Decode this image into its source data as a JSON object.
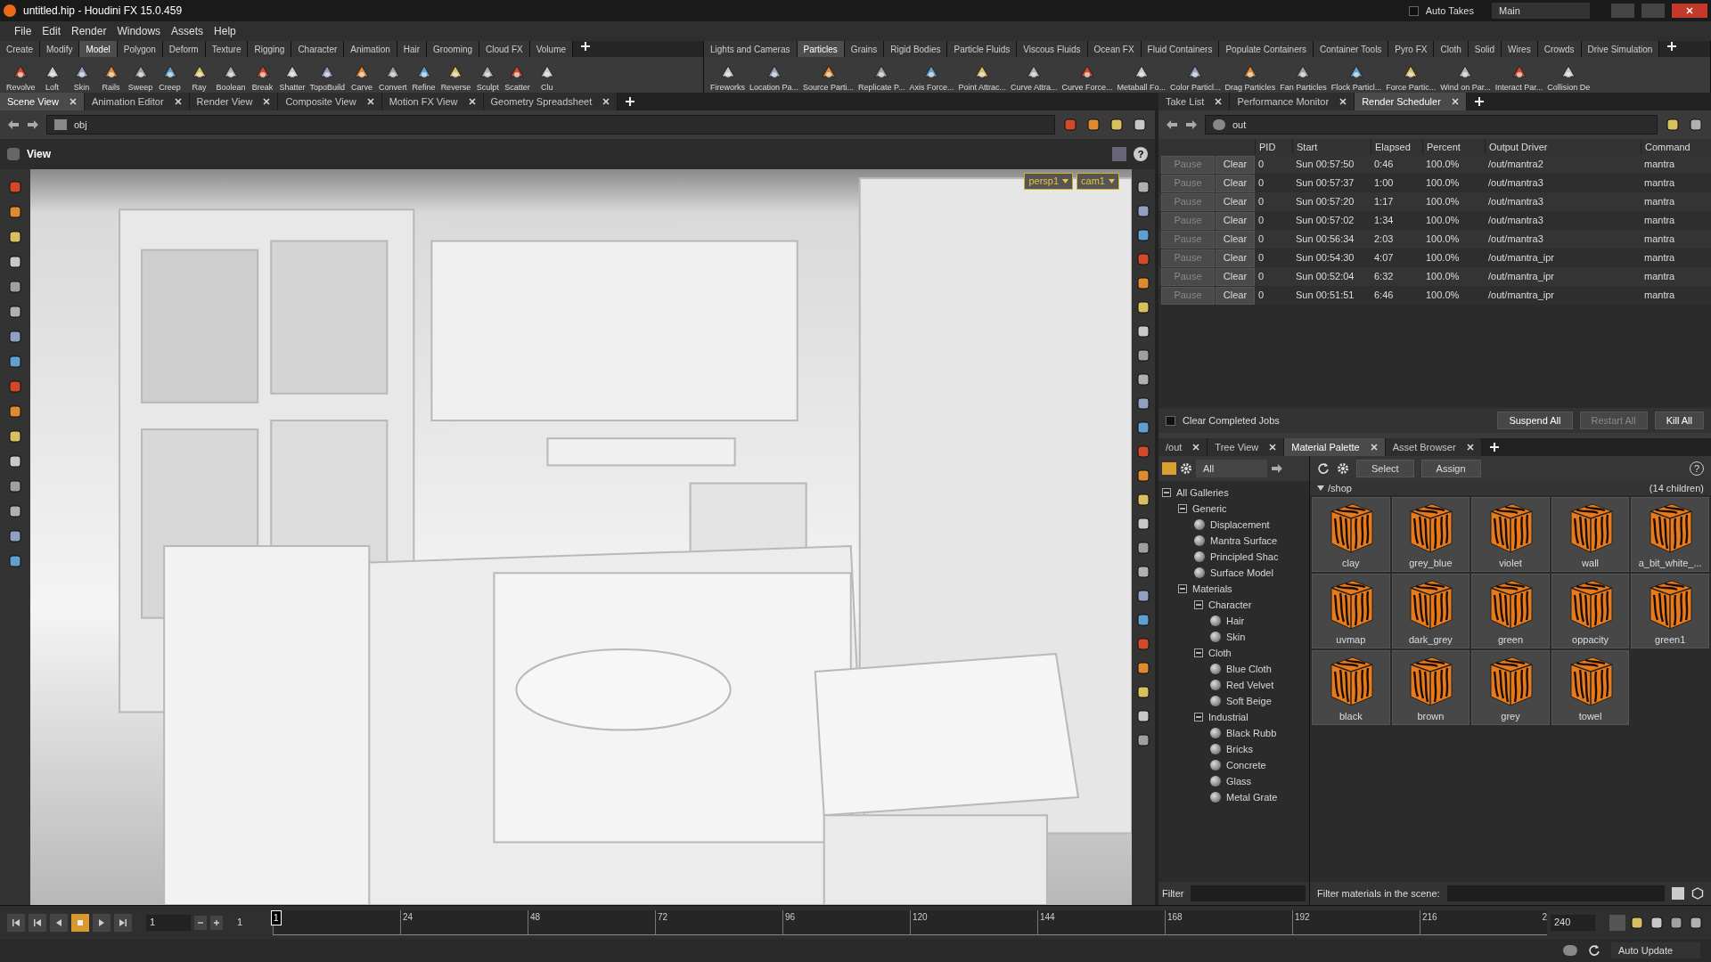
{
  "window": {
    "title": "untitled.hip - Houdini FX 15.0.459",
    "auto_takes": {
      "label": "Auto Takes",
      "checked": false
    },
    "desktop": "Main"
  },
  "menu": [
    "File",
    "Edit",
    "Render",
    "Windows",
    "Assets",
    "Help"
  ],
  "shelves": [
    {
      "tabs": [
        {
          "label": "Create",
          "selected": false
        },
        {
          "label": "Modify",
          "selected": false
        },
        {
          "label": "Model",
          "selected": true
        },
        {
          "label": "Polygon",
          "selected": false
        },
        {
          "label": "Deform",
          "selected": false
        },
        {
          "label": "Texture",
          "selected": false
        },
        {
          "label": "Rigging",
          "selected": false
        },
        {
          "label": "Character",
          "selected": false
        },
        {
          "label": "Animation",
          "selected": false
        },
        {
          "label": "Hair",
          "selected": false
        },
        {
          "label": "Grooming",
          "selected": false
        },
        {
          "label": "Cloud FX",
          "selected": false
        },
        {
          "label": "Volume",
          "selected": false
        }
      ],
      "tools": [
        "Revolve",
        "Loft",
        "Skin",
        "Rails",
        "Sweep",
        "Creep",
        "Ray",
        "Boolean",
        "Break",
        "Shatter",
        "TopoBuild",
        "Carve",
        "Convert",
        "Refine",
        "Reverse",
        "Sculpt",
        "Scatter",
        "Clu"
      ]
    },
    {
      "tabs": [
        {
          "label": "Lights and Cameras",
          "selected": false
        },
        {
          "label": "Particles",
          "selected": true
        },
        {
          "label": "Grains",
          "selected": false
        },
        {
          "label": "Rigid Bodies",
          "selected": false
        },
        {
          "label": "Particle Fluids",
          "selected": false
        },
        {
          "label": "Viscous Fluids",
          "selected": false
        },
        {
          "label": "Ocean FX",
          "selected": false
        },
        {
          "label": "Fluid Containers",
          "selected": false
        },
        {
          "label": "Populate Containers",
          "selected": false
        },
        {
          "label": "Container Tools",
          "selected": false
        },
        {
          "label": "Pyro FX",
          "selected": false
        },
        {
          "label": "Cloth",
          "selected": false
        },
        {
          "label": "Solid",
          "selected": false
        },
        {
          "label": "Wires",
          "selected": false
        },
        {
          "label": "Crowds",
          "selected": false
        },
        {
          "label": "Drive Simulation",
          "selected": false
        }
      ],
      "tools": [
        "Fireworks",
        "Location Pa...",
        "Source Parti...",
        "Replicate P...",
        "Axis Force...",
        "Point Attrac...",
        "Curve Attra...",
        "Curve Force...",
        "Metaball Fo...",
        "Color Particl...",
        "Drag Particles",
        "Fan Particles",
        "Flock Particl...",
        "Force Partic...",
        "Wind on Par...",
        "Interact Par...",
        "Collision De"
      ]
    }
  ],
  "scene_view": {
    "tabs": [
      {
        "label": "Scene View",
        "selected": true
      },
      {
        "label": "Animation Editor",
        "selected": false
      },
      {
        "label": "Render View",
        "selected": false
      },
      {
        "label": "Composite View",
        "selected": false
      },
      {
        "label": "Motion FX View",
        "selected": false
      },
      {
        "label": "Geometry Spreadsheet",
        "selected": false
      }
    ],
    "path": "obj",
    "view_title": "View",
    "camera_menus": [
      "persp1",
      "cam1"
    ],
    "help": "?"
  },
  "render_scheduler": {
    "tabs": [
      {
        "label": "Take List",
        "selected": false
      },
      {
        "label": "Performance Monitor",
        "selected": false
      },
      {
        "label": "Render Scheduler",
        "selected": true
      }
    ],
    "path": "out",
    "columns": [
      "PID",
      "Start",
      "Elapsed",
      "Percent",
      "Output Driver",
      "Command"
    ],
    "rows": [
      {
        "pause": {
          "label": "Pause",
          "disabled": true
        },
        "clear": "Clear",
        "cells": [
          "0",
          "Sun 00:57:50",
          "0:46",
          "100.0%",
          "/out/mantra2",
          "mantra"
        ]
      },
      {
        "pause": {
          "label": "Pause",
          "disabled": true
        },
        "clear": "Clear",
        "cells": [
          "0",
          "Sun 00:57:37",
          "1:00",
          "100.0%",
          "/out/mantra3",
          "mantra"
        ]
      },
      {
        "pause": {
          "label": "Pause",
          "disabled": true
        },
        "clear": "Clear",
        "cells": [
          "0",
          "Sun 00:57:20",
          "1:17",
          "100.0%",
          "/out/mantra3",
          "mantra"
        ]
      },
      {
        "pause": {
          "label": "Pause",
          "disabled": true
        },
        "clear": "Clear",
        "cells": [
          "0",
          "Sun 00:57:02",
          "1:34",
          "100.0%",
          "/out/mantra3",
          "mantra"
        ]
      },
      {
        "pause": {
          "label": "Pause",
          "disabled": true
        },
        "clear": "Clear",
        "cells": [
          "0",
          "Sun 00:56:34",
          "2:03",
          "100.0%",
          "/out/mantra3",
          "mantra"
        ]
      },
      {
        "pause": {
          "label": "Pause",
          "disabled": true
        },
        "clear": "Clear",
        "cells": [
          "0",
          "Sun 00:54:30",
          "4:07",
          "100.0%",
          "/out/mantra_ipr",
          "mantra"
        ]
      },
      {
        "pause": {
          "label": "Pause",
          "disabled": true
        },
        "clear": "Clear",
        "cells": [
          "0",
          "Sun 00:52:04",
          "6:32",
          "100.0%",
          "/out/mantra_ipr",
          "mantra"
        ]
      },
      {
        "pause": {
          "label": "Pause",
          "disabled": true
        },
        "clear": "Clear",
        "cells": [
          "0",
          "Sun 00:51:51",
          "6:46",
          "100.0%",
          "/out/mantra_ipr",
          "mantra"
        ]
      }
    ],
    "clear_completed": {
      "label": "Clear Completed Jobs",
      "checked": false
    },
    "buttons": [
      {
        "label": "Suspend All",
        "disabled": false
      },
      {
        "label": "Restart All",
        "disabled": true
      },
      {
        "label": "Kill All",
        "disabled": false
      }
    ]
  },
  "material_palette": {
    "tabs": [
      {
        "label": "/out",
        "selected": false
      },
      {
        "label": "Tree View",
        "selected": false
      },
      {
        "label": "Material Palette",
        "selected": true
      },
      {
        "label": "Asset Browser",
        "selected": false
      }
    ],
    "gallery_filter": "All",
    "tree": [
      {
        "label": "All Galleries",
        "expanded": true,
        "children": [
          {
            "label": "Generic",
            "expanded": true,
            "children": [
              {
                "label": "Displacement"
              },
              {
                "label": "Mantra Surface"
              },
              {
                "label": "Principled Shac"
              },
              {
                "label": "Surface Model"
              }
            ]
          },
          {
            "label": "Materials",
            "expanded": true,
            "children": [
              {
                "label": "Character",
                "expanded": true,
                "children": [
                  {
                    "label": "Hair"
                  },
                  {
                    "label": "Skin"
                  }
                ]
              },
              {
                "label": "Cloth",
                "expanded": true,
                "children": [
                  {
                    "label": "Blue Cloth"
                  },
                  {
                    "label": "Red Velvet"
                  },
                  {
                    "label": "Soft Beige"
                  }
                ]
              },
              {
                "label": "Industrial",
                "expanded": true,
                "children": [
                  {
                    "label": "Black Rubb"
                  },
                  {
                    "label": "Bricks"
                  },
                  {
                    "label": "Concrete"
                  },
                  {
                    "label": "Glass"
                  },
                  {
                    "label": "Metal Grate"
                  }
                ]
              }
            ]
          }
        ]
      }
    ],
    "filter_label": "Filter",
    "buttons": [
      "Select",
      "Assign"
    ],
    "shop_path": "/shop",
    "children_count": "(14 children)",
    "materials": [
      "clay",
      "grey_blue",
      "violet",
      "wall",
      "a_bit_white_...",
      "uvmap",
      "dark_grey",
      "green",
      "oppacity",
      "green1",
      "black",
      "brown",
      "grey",
      "towel"
    ],
    "scene_filter_label": "Filter materials in the scene:",
    "help": "?"
  },
  "timeline": {
    "start": "1",
    "current": "1",
    "end": "240",
    "marker": "1",
    "ticks": [
      "24",
      "48",
      "72",
      "96",
      "120",
      "144",
      "168",
      "192",
      "216"
    ],
    "end_tick": "2",
    "level": 0
  },
  "status_bar": {
    "update_mode": "Auto Update"
  }
}
